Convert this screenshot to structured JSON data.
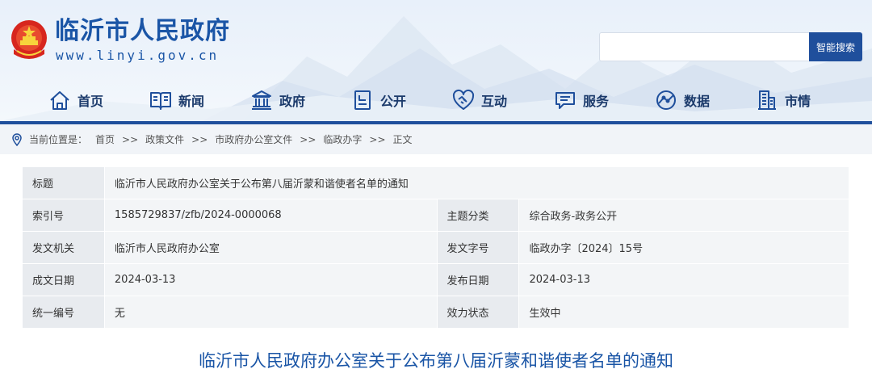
{
  "header": {
    "site_title": "临沂市人民政府",
    "site_url": "www.linyi.gov.cn",
    "search_placeholder": "",
    "search_button": "智能搜索",
    "brand_color": "#1a55a6"
  },
  "nav": {
    "items": [
      {
        "label": "首页",
        "icon": "home-icon"
      },
      {
        "label": "新闻",
        "icon": "book-icon"
      },
      {
        "label": "政府",
        "icon": "government-building-icon"
      },
      {
        "label": "公开",
        "icon": "document-icon"
      },
      {
        "label": "互动",
        "icon": "handshake-icon"
      },
      {
        "label": "服务",
        "icon": "chat-icon"
      },
      {
        "label": "数据",
        "icon": "data-icon"
      },
      {
        "label": "市情",
        "icon": "city-icon"
      }
    ]
  },
  "breadcrumb": {
    "prefix": "当前位置是：",
    "items": [
      "首页",
      "政策文件",
      "市政府办公室文件",
      "临政办字",
      "正文"
    ],
    "separator": ">>"
  },
  "info": {
    "title_label": "标题",
    "title_value": "临沂市人民政府办公室关于公布第八届沂蒙和谐使者名单的通知",
    "index_label": "索引号",
    "index_value": "1585729837/zfb/2024-0000068",
    "topic_label": "主题分类",
    "topic_value": "综合政务-政务公开",
    "issuer_label": "发文机关",
    "issuer_value": "临沂市人民政府办公室",
    "docno_label": "发文字号",
    "docno_value": "临政办字〔2024〕15号",
    "written_label": "成文日期",
    "written_value": "2024-03-13",
    "published_label": "发布日期",
    "published_value": "2024-03-13",
    "serial_label": "统一编号",
    "serial_value": "无",
    "status_label": "效力状态",
    "status_value": "生效中"
  },
  "article": {
    "title": "临沂市人民政府办公室关于公布第八届沂蒙和谐使者名单的通知"
  }
}
